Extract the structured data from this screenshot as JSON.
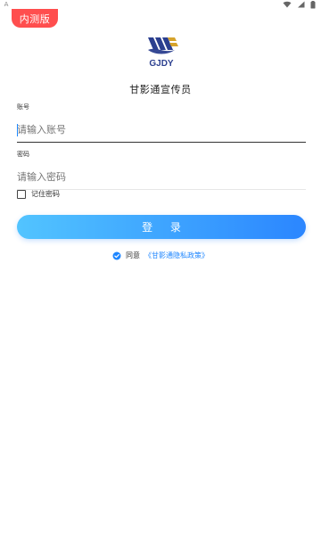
{
  "status_bar": {
    "left_glyph": "A",
    "icons": [
      "wifi-icon",
      "signal-icon",
      "battery-icon"
    ]
  },
  "badge": {
    "label": "内测版",
    "color": "#ff4e4e"
  },
  "logo": {
    "text": "GJDY"
  },
  "app_title": "甘影通宣传员",
  "form": {
    "account": {
      "label": "账号",
      "placeholder": "请输入账号",
      "value": ""
    },
    "password": {
      "label": "密码",
      "placeholder": "请输入密码",
      "value": ""
    },
    "remember_label": "记住密码",
    "login_label": "登 录"
  },
  "agreement": {
    "prefix": "同意",
    "link": "《甘影通隐私政策》"
  },
  "colors": {
    "primary_start": "#52c4ff",
    "primary_end": "#2b86ff",
    "link": "#1e86ff"
  }
}
